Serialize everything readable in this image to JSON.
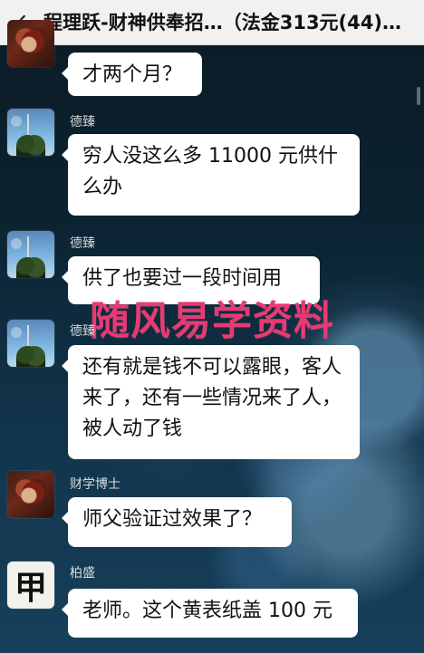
{
  "header": {
    "title": "程理跃-财神供奉招…（法金313元(44)…",
    "back_icon": "chevron-left-icon"
  },
  "watermark": {
    "text": "随风易学资料"
  },
  "messages": [
    {
      "sender": "",
      "avatar": "warrior-avatar",
      "text": "才两个月？"
    },
    {
      "sender": "德臻",
      "avatar": "sky-avatar",
      "text": "穷人没这么多 11000 元供什么办"
    },
    {
      "sender": "德臻",
      "avatar": "sky-avatar",
      "text": "供了也要过一段时间用"
    },
    {
      "sender": "德臻",
      "avatar": "sky-avatar",
      "text": "还有就是钱不可以露眼，客人来了，还有一些情况来了人，被人动了钱"
    },
    {
      "sender": "财学博士",
      "avatar": "warrior-avatar",
      "text": "师父验证过效果了？"
    },
    {
      "sender": "柏盛",
      "avatar": "character-avatar",
      "avatar_text": "甲",
      "text": "老师。这个黄表纸盖 100 元"
    }
  ],
  "colors": {
    "header_bg": "#f1f1f1",
    "bubble_bg": "#ffffff",
    "watermark": "#e83a72"
  }
}
